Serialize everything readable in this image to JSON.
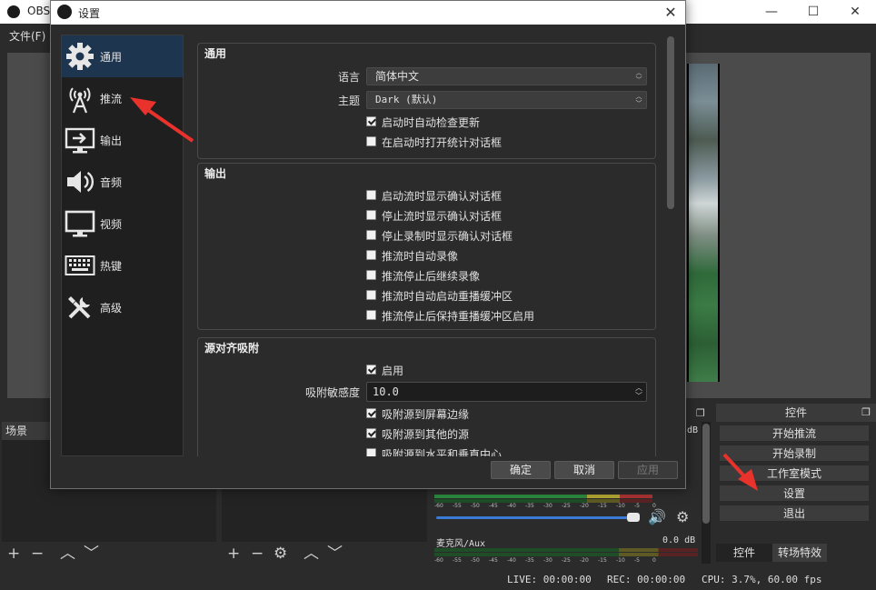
{
  "main_window": {
    "title": "OBS",
    "menu": "文件(F)",
    "controls": {
      "minimize": "—",
      "maximize": "☐",
      "close": "✕"
    }
  },
  "docks": {
    "scenes": {
      "title": "场景"
    },
    "controls": {
      "title": "控件",
      "buttons": [
        "开始推流",
        "开始录制",
        "工作室模式",
        "设置",
        "退出"
      ],
      "tabs": [
        "控件",
        "转场特效"
      ]
    },
    "mixer": {
      "channel1": {
        "name": "麦克风/Aux",
        "db": "0.0 dB"
      },
      "ticks": [
        "-60",
        "-55",
        "-50",
        "-45",
        "-40",
        "-35",
        "-30",
        "-25",
        "-20",
        "-15",
        "-10",
        "-5",
        "0"
      ],
      "db_unit": "dB"
    }
  },
  "statusbar": {
    "live": "LIVE: 00:00:00",
    "rec": "REC: 00:00:00",
    "cpu": "CPU: 3.7%, 60.00 fps"
  },
  "settings": {
    "title": "设置",
    "close": "✕",
    "sidebar": [
      {
        "label": "通用",
        "icon": "gear-icon",
        "active": true
      },
      {
        "label": "推流",
        "icon": "antenna-icon",
        "active": false
      },
      {
        "label": "输出",
        "icon": "output-monitor-icon",
        "active": false
      },
      {
        "label": "音频",
        "icon": "speaker-icon",
        "active": false
      },
      {
        "label": "视频",
        "icon": "monitor-icon",
        "active": false
      },
      {
        "label": "热键",
        "icon": "keyboard-icon",
        "active": false
      },
      {
        "label": "高级",
        "icon": "tools-icon",
        "active": false
      }
    ],
    "general": {
      "title": "通用",
      "language_label": "语言",
      "language_value": "简体中文",
      "theme_label": "主题",
      "theme_value": "Dark (默认)",
      "checks": [
        {
          "label": "启动时自动检查更新",
          "checked": true
        },
        {
          "label": "在启动时打开统计对话框",
          "checked": false
        }
      ]
    },
    "output": {
      "title": "输出",
      "checks": [
        {
          "label": "启动流时显示确认对话框",
          "checked": false
        },
        {
          "label": "停止流时显示确认对话框",
          "checked": false
        },
        {
          "label": "停止录制时显示确认对话框",
          "checked": false
        },
        {
          "label": "推流时自动录像",
          "checked": false
        },
        {
          "label": "推流停止后继续录像",
          "checked": false
        },
        {
          "label": "推流时自动启动重播缓冲区",
          "checked": false
        },
        {
          "label": "推流停止后保持重播缓冲区启用",
          "checked": false
        }
      ]
    },
    "snapping": {
      "title": "源对齐吸附",
      "enable": {
        "label": "启用",
        "checked": true
      },
      "sensitivity_label": "吸附敏感度",
      "sensitivity_value": "10.0",
      "checks": [
        {
          "label": "吸附源到屏幕边缘",
          "checked": true
        },
        {
          "label": "吸附源到其他的源",
          "checked": true
        },
        {
          "label": "吸附源到水平和垂直中心",
          "checked": false
        }
      ]
    },
    "buttons": {
      "ok": "确定",
      "cancel": "取消",
      "apply": "应用"
    }
  },
  "colors": {
    "accent_selected": "#1e3550",
    "annotation_arrow": "#e8322b",
    "mixer_green": "#2b8a3e",
    "mixer_yellow": "#b2a633",
    "mixer_red": "#aa3333",
    "slider_blue": "#3a7bd5"
  }
}
